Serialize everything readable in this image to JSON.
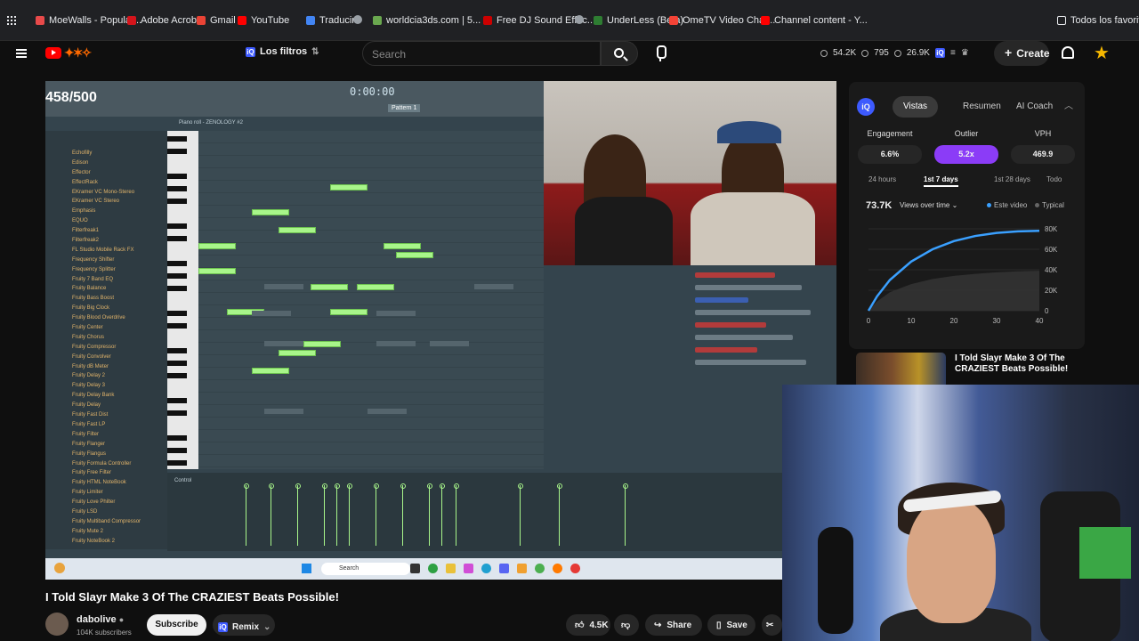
{
  "bookmarks": [
    {
      "label": "MoeWalls - Popular...",
      "color": "#e84a4a"
    },
    {
      "label": "Adobe Acrobat",
      "color": "#d4141b"
    },
    {
      "label": "Gmail",
      "color": "#ea4335"
    },
    {
      "label": "YouTube",
      "color": "#ff0000"
    },
    {
      "label": "Traducir",
      "color": "#4285f4"
    },
    {
      "label": "worldcia3ds.com | 5...",
      "color": "#6aa84f"
    },
    {
      "label": "Free DJ Sound Effec...",
      "color": "#cc0000"
    },
    {
      "label": "UnderLess (Beta)",
      "color": "#2e7d32"
    },
    {
      "label": "OmeTV Video Chat...",
      "color": "#f44336"
    },
    {
      "label": "Channel content - Y...",
      "color": "#ff0000"
    }
  ],
  "bookmarks_folder": "Todos los favoritos",
  "header": {
    "filters_label": "Los filtros",
    "search_placeholder": "Search",
    "stat_views": "54.2K",
    "stat_likes": "795",
    "stat_subs": "26.9K",
    "create_label": "Create"
  },
  "video": {
    "counter": "458/500",
    "time": "0:00:00",
    "pattern": "Pattern 1",
    "piano_roll": "Piano roll - ZENOLOGY #2",
    "control_label": "Control",
    "taskbar_search": "Search",
    "browser_items": [
      "Echofilly",
      "Edison",
      "Effector",
      "EffectRack",
      "EKramer VC Mono-Stereo",
      "EKramer VC Stereo",
      "Emphasis",
      "EQUO",
      "Filterfreak1",
      "Filterfreak2",
      "FL Studio Mobile Rack FX",
      "Frequency Shifter",
      "Frequency Splitter",
      "Fruity 7 Band EQ",
      "Fruity Balance",
      "Fruity Bass Boost",
      "Fruity Big Clock",
      "Fruity Blood Overdrive",
      "Fruity Center",
      "Fruity Chorus",
      "Fruity Compressor",
      "Fruity Convolver",
      "Fruity dB Meter",
      "Fruity Delay 2",
      "Fruity Delay 3",
      "Fruity Delay Bank",
      "Fruity Delay",
      "Fruity Fast Dist",
      "Fruity Fast LP",
      "Fruity Filter",
      "Fruity Flanger",
      "Fruity Flangus",
      "Fruity Formula Controller",
      "Fruity Free Filter",
      "Fruity HTML NoteBook",
      "Fruity Limiter",
      "Fruity Love Philter",
      "Fruity LSD",
      "Fruity Multiband Compressor",
      "Fruity Mute 2",
      "Fruity NoteBook 2"
    ]
  },
  "panel": {
    "tabs": [
      "Vistas",
      "Resumen",
      "AI Coach"
    ],
    "metrics": [
      {
        "label": "Engagement",
        "value": "6.6%"
      },
      {
        "label": "Outlier",
        "value": "5.2x"
      },
      {
        "label": "VPH",
        "value": "469.9"
      }
    ],
    "ranges": [
      "24 hours",
      "1st 7 days",
      "1st 28 days",
      "Todo"
    ],
    "views_total": "73.7K",
    "views_selector": "Views over time",
    "legend_this": "Este video",
    "legend_typical": "Typical",
    "colors": {
      "accent": "#3d5afe",
      "outlier": "#8b3cf7",
      "line": "#3aa0ff"
    }
  },
  "chart_data": {
    "type": "line",
    "x": [
      0,
      2,
      5,
      10,
      15,
      20,
      25,
      30,
      35,
      40
    ],
    "series": [
      {
        "name": "Este video",
        "values": [
          0,
          14000,
          30000,
          48000,
          60000,
          68000,
          73000,
          76000,
          77500,
          78000
        ]
      },
      {
        "name": "Typical",
        "values": [
          0,
          9000,
          18000,
          26000,
          31000,
          34000,
          36000,
          37500,
          38500,
          39000
        ]
      }
    ],
    "xticks": [
      "0",
      "10",
      "20",
      "30",
      "40"
    ],
    "yticks": [
      "0",
      "20K",
      "40K",
      "60K",
      "80K"
    ],
    "xlim": [
      0,
      40
    ],
    "ylim": [
      0,
      80000
    ]
  },
  "recommended": {
    "title": "I Told Slayr Make 3 Of The CRAZIEST Beats Possible!"
  },
  "below": {
    "title": "I Told Slayr Make 3 Of The CRAZIEST Beats Possible!",
    "channel": "dabolive",
    "subscribers": "104K subscribers",
    "subscribe_label": "Subscribe",
    "remix_label": "Remix",
    "likes": "4.5K",
    "share_label": "Share",
    "save_label": "Save"
  }
}
